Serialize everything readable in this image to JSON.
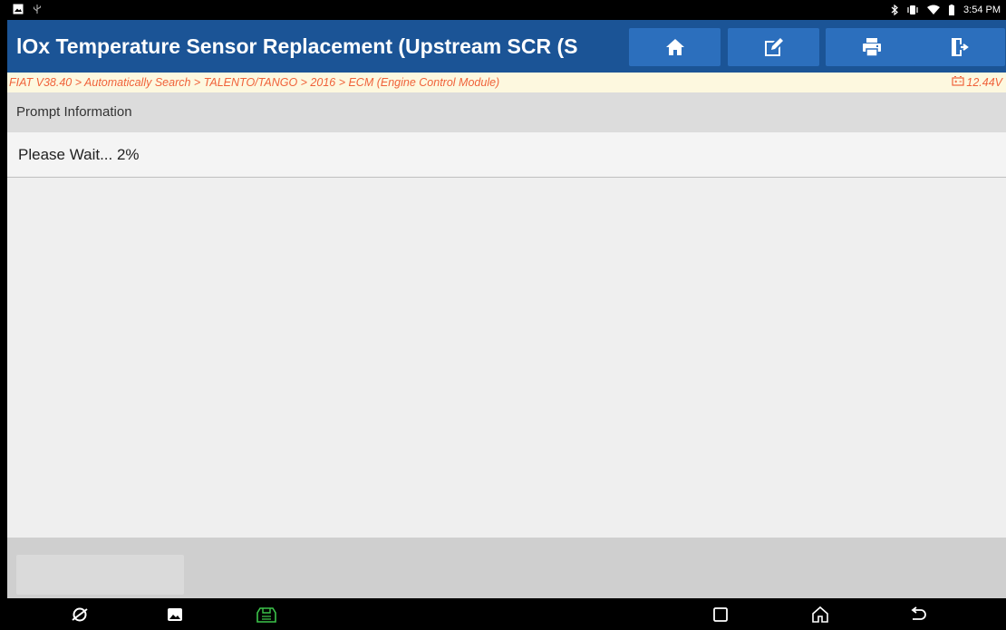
{
  "status_bar": {
    "time": "3:54 PM",
    "left_icons": [
      "image-notification-icon",
      "usb-debug-icon"
    ],
    "right_icons": [
      "bluetooth-icon",
      "vibrate-icon",
      "wifi-icon",
      "battery-icon"
    ]
  },
  "header": {
    "title": "lOx Temperature Sensor Replacement (Upstream SCR (S",
    "buttons": [
      "home-icon",
      "edit-report-icon",
      "print-icon",
      "exit-icon"
    ]
  },
  "breadcrumb": {
    "path": "FIAT V38.40 > Automatically Search > TALENTO/TANGO > 2016 > ECM (Engine Control Module)",
    "voltage": "12.44V"
  },
  "prompt": {
    "header": "Prompt Information",
    "message": "Please Wait... 2%"
  },
  "navigation_bar": {
    "icons": [
      "browser-icon",
      "gallery-icon",
      "vci-icon",
      "recents-icon",
      "home-icon",
      "back-icon"
    ]
  },
  "colors": {
    "title_bar": "#1b5496",
    "title_button": "#2c6fbd",
    "breadcrumb_text": "#f0623a",
    "breadcrumb_bg": "#fdf8df",
    "vci_icon": "#3cc44a"
  }
}
